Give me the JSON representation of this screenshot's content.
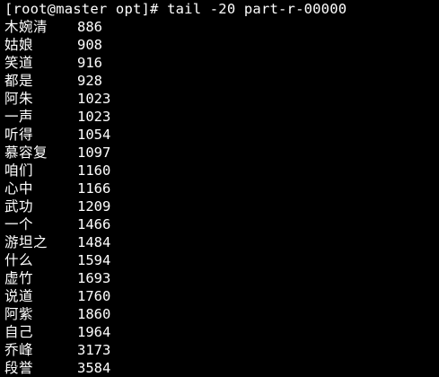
{
  "terminal": {
    "prompt": "[root@master opt]# tail -20 part-r-00000",
    "rows": [
      {
        "word": "木婉清",
        "count": "886"
      },
      {
        "word": "姑娘",
        "count": "908"
      },
      {
        "word": "笑道",
        "count": "916"
      },
      {
        "word": "都是",
        "count": "928"
      },
      {
        "word": "阿朱",
        "count": "1023"
      },
      {
        "word": "一声",
        "count": "1023"
      },
      {
        "word": "听得",
        "count": "1054"
      },
      {
        "word": "慕容复",
        "count": "1097"
      },
      {
        "word": "咱们",
        "count": "1160"
      },
      {
        "word": "心中",
        "count": "1166"
      },
      {
        "word": "武功",
        "count": "1209"
      },
      {
        "word": "一个",
        "count": "1466"
      },
      {
        "word": "游坦之",
        "count": "1484"
      },
      {
        "word": "什么",
        "count": "1594"
      },
      {
        "word": "虚竹",
        "count": "1693"
      },
      {
        "word": "说道",
        "count": "1760"
      },
      {
        "word": "阿紫",
        "count": "1860"
      },
      {
        "word": "自己",
        "count": "1964"
      },
      {
        "word": "乔峰",
        "count": "3173"
      },
      {
        "word": "段誉",
        "count": "3584"
      }
    ],
    "colors": {
      "background": "#000000",
      "foreground": "#ffffff"
    }
  }
}
